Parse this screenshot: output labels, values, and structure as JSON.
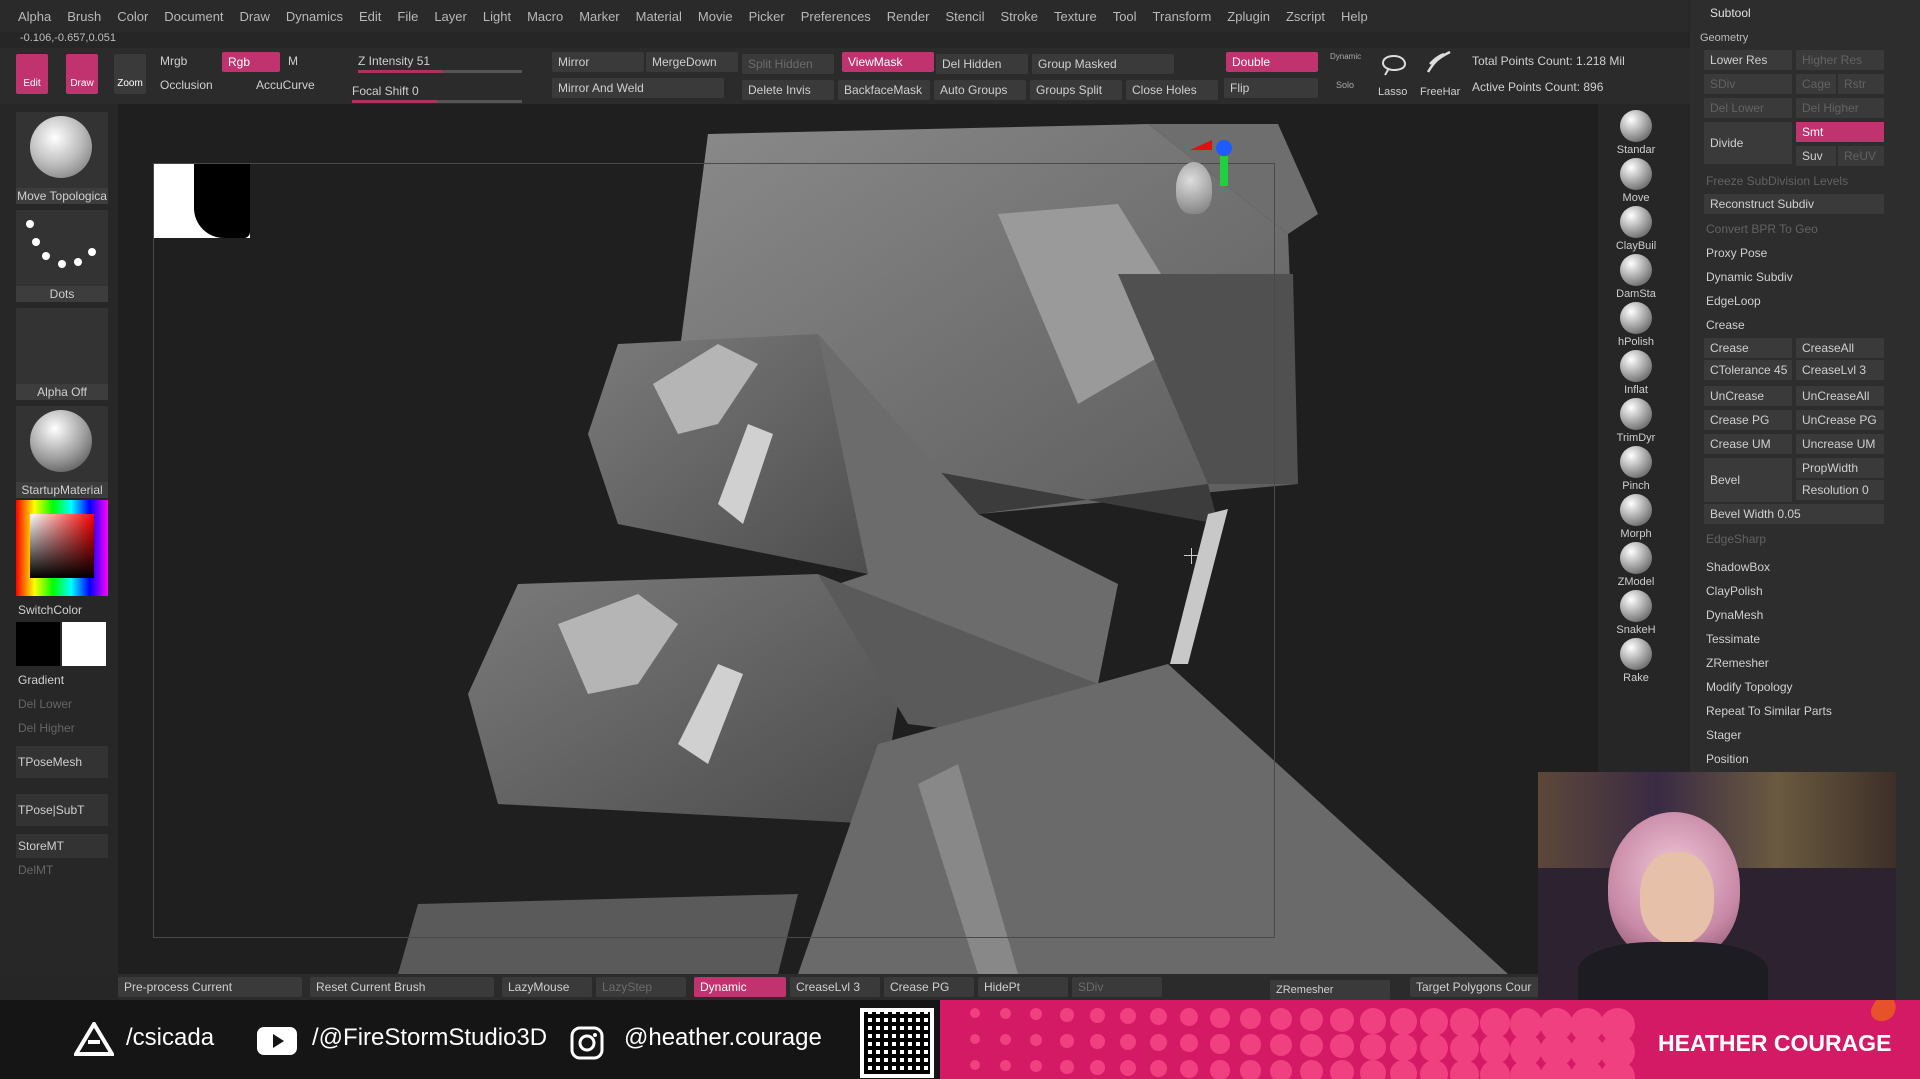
{
  "menu": [
    "Alpha",
    "Brush",
    "Color",
    "Document",
    "Draw",
    "Dynamics",
    "Edit",
    "File",
    "Layer",
    "Light",
    "Macro",
    "Marker",
    "Material",
    "Movie",
    "Picker",
    "Preferences",
    "Render",
    "Stencil",
    "Stroke",
    "Texture",
    "Tool",
    "Transform",
    "Zplugin",
    "Zscript",
    "Help"
  ],
  "coords": "-0.106,-0.657,0.051",
  "toolbar": {
    "edit": "Edit",
    "draw": "Draw",
    "zoom": "Zoom",
    "mrgb": "Mrgb",
    "rgb": "Rgb",
    "m": "M",
    "occlusion": "Occlusion",
    "accucurve": "AccuCurve",
    "z_intensity_label": "Z Intensity",
    "z_intensity": "51",
    "z_intensity_level": 0.51,
    "focal_shift_label": "Focal Shift",
    "focal_shift": "0",
    "mirror": "Mirror",
    "mergedown": "MergeDown",
    "split_hidden": "Split Hidden",
    "viewmask": "ViewMask",
    "del_hidden": "Del Hidden",
    "group_masked": "Group Masked",
    "double": "Double",
    "dynamic": "Dynamic",
    "solo": "Solo",
    "mirror_weld": "Mirror And Weld",
    "delete_invis": "Delete Invis",
    "backfacemask": "BackfaceMask",
    "auto_groups": "Auto Groups",
    "groups_split": "Groups Split",
    "close_holes": "Close Holes",
    "flip": "Flip",
    "lasso": "Lasso",
    "freehand": "FreeHar",
    "total_points": "Total Points Count: 1.218 Mil",
    "active_points": "Active Points Count: 896"
  },
  "leftshelf": {
    "brush": "Move Topologica",
    "stroke": "Dots",
    "alpha": "Alpha Off",
    "material": "StartupMaterial",
    "switchcolor": "SwitchColor",
    "gradient": "Gradient",
    "del_lower": "Del Lower",
    "del_higher": "Del Higher",
    "tposemesh": "TPoseMesh",
    "tpose_subt": "TPose|SubT",
    "storemt": "StoreMT",
    "delmt": "DelMT"
  },
  "brushes": [
    "Standar",
    "Move",
    "ClayBuil",
    "DamSta",
    "hPolish",
    "Inflat",
    "TrimDyr",
    "Pinch",
    "Morph",
    "ZModel",
    "SnakeH",
    "Rake"
  ],
  "panel": {
    "title": "Subtool",
    "geometry": "Geometry",
    "lower_res": "Lower Res",
    "higher_res": "Higher Res",
    "sdiv": "SDiv",
    "cage": "Cage",
    "rstr": "Rstr",
    "del_lower": "Del Lower",
    "del_higher": "Del Higher",
    "divide": "Divide",
    "smt": "Smt",
    "suv": "Suv",
    "reuv": "ReUV",
    "freeze": "Freeze SubDivision Levels",
    "reconstruct": "Reconstruct Subdiv",
    "convert_bpr": "Convert BPR To Geo",
    "proxy_pose": "Proxy Pose",
    "dynamic_subdiv": "Dynamic Subdiv",
    "edgeloop": "EdgeLoop",
    "crease_section": "Crease",
    "crease": "Crease",
    "creaseall": "CreaseAll",
    "ctolerance": "CTolerance 45",
    "creaselvl": "CreaseLvl 3",
    "uncrease": "UnCrease",
    "uncreaseall": "UnCreaseAll",
    "crease_pg": "Crease PG",
    "uncrease_pg": "UnCrease PG",
    "crease_um": "Crease UM",
    "uncrease_um": "Uncrease UM",
    "bevel": "Bevel",
    "propwidth": "PropWidth",
    "resolution": "Resolution 0",
    "bevel_width": "Bevel Width 0.05",
    "edgesharp": "EdgeSharp",
    "shadowbox": "ShadowBox",
    "claypolish": "ClayPolish",
    "dynamesh": "DynaMesh",
    "tessimate": "Tessimate",
    "zremesher": "ZRemesher",
    "modify_topology": "Modify Topology",
    "repeat_similar": "Repeat To Similar Parts",
    "stager": "Stager",
    "position": "Position"
  },
  "bottombar": {
    "preprocess": "Pre-process Current",
    "reset_brush": "Reset Current Brush",
    "lazymouse": "LazyMouse",
    "lazystep": "LazyStep",
    "dynamic": "Dynamic",
    "creaselvl": "CreaseLvl 3",
    "crease_pg": "Crease PG",
    "hidept": "HidePt",
    "sdiv": "SDiv",
    "zremesher": "ZRemesher",
    "target_polygons": "Target Polygons Cour"
  },
  "overlay": {
    "handle1": "/csicada",
    "handle2": "/@FireStormStudio3D",
    "handle3": "@heather.courage",
    "name": "HEATHER COURAGE"
  },
  "colors": {
    "accent": "#c0336f",
    "overlay_pink": "#d41a65"
  }
}
